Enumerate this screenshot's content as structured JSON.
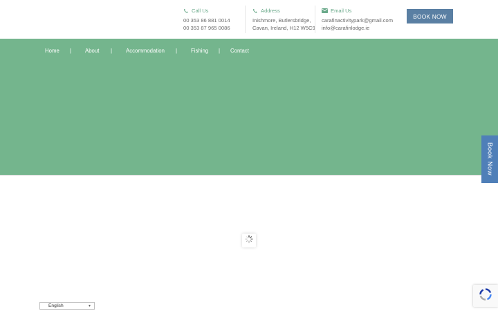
{
  "header": {
    "call": {
      "title": "Call Us",
      "lines": [
        "00 353 86 881 0014",
        "00 353 87 965 0086"
      ]
    },
    "address": {
      "title": "Address",
      "lines": [
        "Inishmore, Butlersbridge,",
        "Cavan, Ireland, H12 W5C9"
      ]
    },
    "email": {
      "title": "Email Us",
      "lines": [
        "carafinactivitypark@gmail.com",
        "info@carafinlodge.ie"
      ]
    },
    "book_label": "BOOK NOW"
  },
  "nav": {
    "items": [
      "Home",
      "About",
      "Accommodation",
      "Fishing",
      "Contact"
    ],
    "separator": "|"
  },
  "side_tab": {
    "label": "Book Now"
  },
  "language": {
    "selected": "English"
  },
  "colors": {
    "hero": "#74b58d",
    "accent": "#6aa98a",
    "button": "#5a7fa3",
    "side_tab": "#4f7fb8"
  },
  "icons": [
    "phone-icon",
    "map-pin-icon",
    "envelope-icon",
    "loading-spinner-icon",
    "recaptcha-icon"
  ]
}
